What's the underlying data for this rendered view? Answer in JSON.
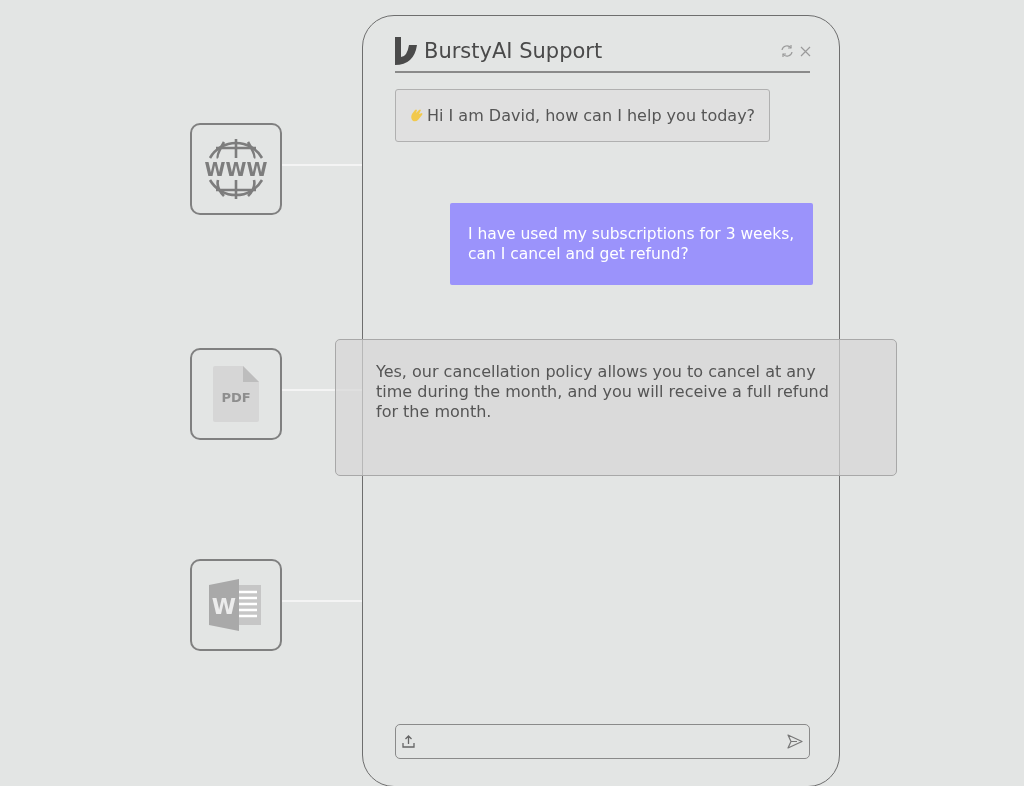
{
  "sources": [
    {
      "kind": "web",
      "label": "WWW"
    },
    {
      "kind": "pdf",
      "label": "PDF"
    },
    {
      "kind": "word",
      "label": "W"
    }
  ],
  "chat": {
    "title": "BurstyAI Support",
    "messages": [
      {
        "kind": "bot",
        "text": "Hi I am David, how can I help you today?"
      },
      {
        "kind": "user",
        "text": "I have used my subscriptions for 3 weeks, can I cancel and get refund?"
      },
      {
        "kind": "reply",
        "text": "Yes, our cancellation policy allows you to cancel at any time during the month, and you will receive a full refund for the month."
      }
    ]
  }
}
